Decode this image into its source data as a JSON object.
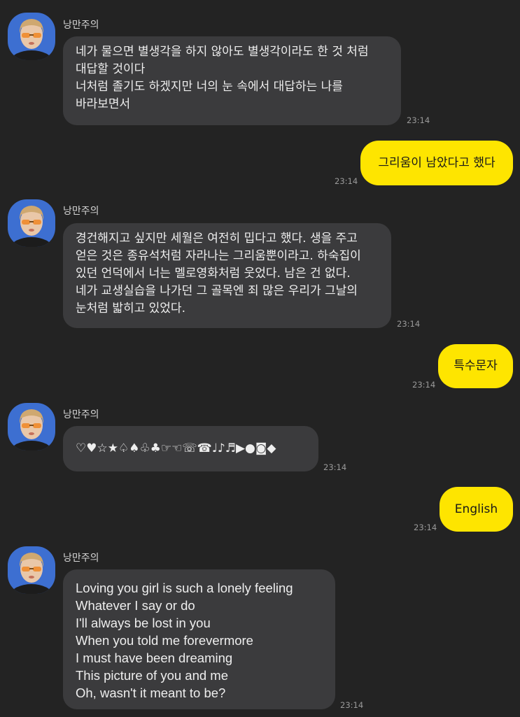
{
  "messages": [
    {
      "sender": "낭만주의",
      "time": "23:14",
      "lines": [
        "네가 물으면 별생각을 하지 않아도 별생각이라도 한 것 처럼",
        "대답할 것이다",
        "너처럼 졸기도 하겠지만 너의 눈 속에서 대답하는 나를",
        "바라보면서"
      ]
    },
    {
      "outgoing": true,
      "time": "23:14",
      "text": "그리움이 남았다고 했다"
    },
    {
      "sender": "낭만주의",
      "time": "23:14",
      "lines": [
        "경건해지고 싶지만 세월은 여전히 밉다고 했다. 생을 주고",
        "얻은 것은 종유석처럼 자라나는 그리움뿐이라고. 하숙집이",
        "있던 언덕에서 너는 멜로영화처럼 웃었다. 남은 건 없다.",
        "네가 교생실습을 나가던 그 골목엔 죄 많은 우리가 그날의",
        "눈처럼 밟히고 있었다."
      ]
    },
    {
      "outgoing": true,
      "time": "23:14",
      "text": "특수문자"
    },
    {
      "sender": "낭만주의",
      "time": "23:14",
      "symbols": "♡♥☆★♤♠♧♣☞☜☏☎♩♪♬▶●◙◆"
    },
    {
      "outgoing": true,
      "time": "23:14",
      "text": "English"
    },
    {
      "sender": "낭만주의",
      "time": "23:14",
      "lines": [
        "Loving you girl is such a lonely feeling",
        "Whatever I say or do",
        "I'll always be lost in you",
        "When you told me forevermore",
        "I must have been dreaming",
        "This picture of you and me",
        "Oh, wasn't it meant to be?"
      ]
    }
  ],
  "colors": {
    "background": "#232323",
    "incoming_bubble": "#3b3b3d",
    "outgoing_bubble": "#fee500",
    "timestamp": "#9a9a9a"
  },
  "icons": {
    "avatar": "profile-photo-woman-orange-sunglasses"
  }
}
